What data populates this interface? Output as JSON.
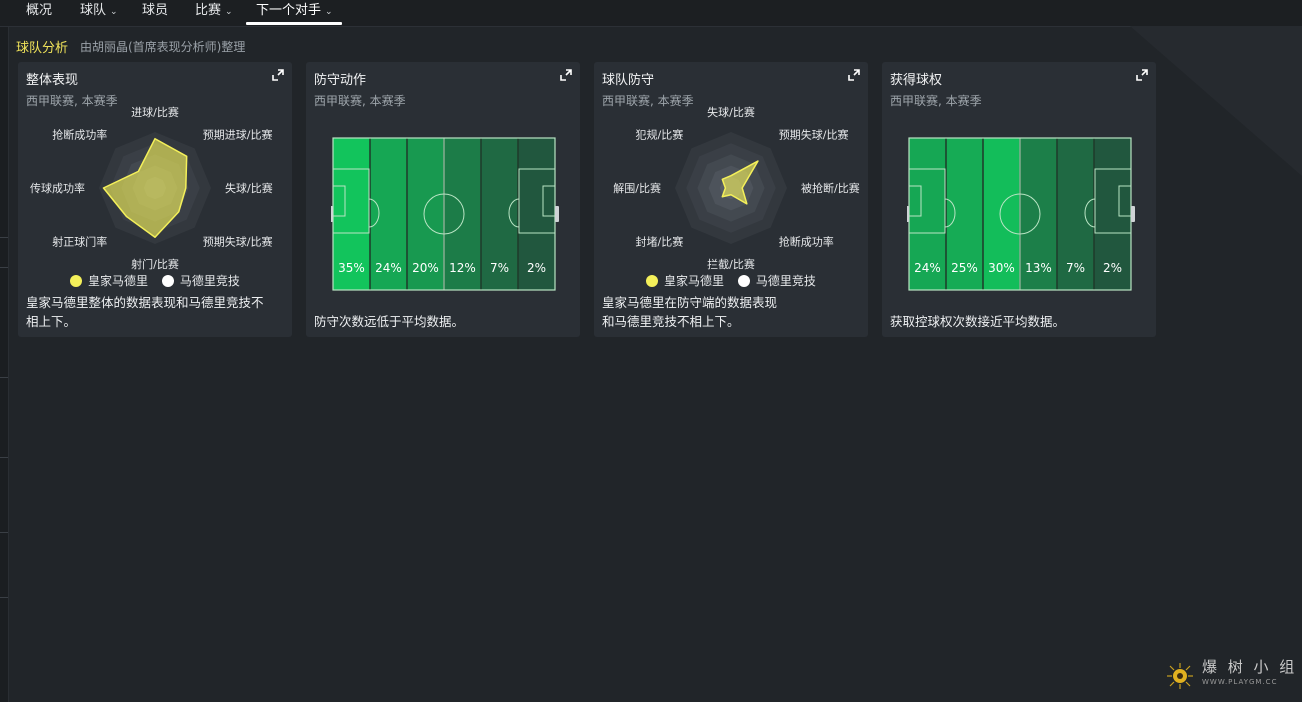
{
  "nav": {
    "items": [
      {
        "label": "概况",
        "dropdown": false
      },
      {
        "label": "球队",
        "dropdown": true
      },
      {
        "label": "球员",
        "dropdown": false
      },
      {
        "label": "比赛",
        "dropdown": true
      },
      {
        "label": "下一个对手",
        "dropdown": true,
        "active": true
      }
    ]
  },
  "section": {
    "title": "球队分析",
    "subtitle": "由胡丽晶(首席表现分析师)整理"
  },
  "cards": [
    {
      "title": "整体表现",
      "subtitle": "西甲联赛, 本赛季",
      "type": "radar",
      "axes": [
        "进球/比赛",
        "预期进球/比赛",
        "失球/比赛",
        "预期失球/比赛",
        "射门/比赛",
        "射正球门率",
        "传球成功率",
        "抢断成功率"
      ],
      "series_values": [
        0.88,
        0.8,
        0.55,
        0.6,
        0.88,
        0.72,
        0.92,
        0.42
      ],
      "legend": [
        "皇家马德里",
        "马德里竞技"
      ],
      "description": [
        "皇家马德里整体的数据表现和马德里竞技不",
        "相上下。"
      ]
    },
    {
      "title": "防守动作",
      "subtitle": "西甲联赛, 本赛季",
      "type": "pitch",
      "zones": [
        "35%",
        "24%",
        "20%",
        "12%",
        "7%",
        "2%"
      ],
      "zone_values": [
        35,
        24,
        20,
        12,
        7,
        2
      ],
      "description": [
        "防守次数远低于平均数据。"
      ]
    },
    {
      "title": "球队防守",
      "subtitle": "西甲联赛, 本赛季",
      "type": "radar",
      "axes": [
        "失球/比赛",
        "预期失球/比赛",
        "被抢断/比赛",
        "抢断成功率",
        "拦截/比赛",
        "封堵/比赛",
        "解围/比赛",
        "犯规/比赛"
      ],
      "series_values": [
        0.22,
        0.68,
        0.2,
        0.4,
        0.12,
        0.22,
        0.1,
        0.22
      ],
      "legend": [
        "皇家马德里",
        "马德里竞技"
      ],
      "description": [
        "皇家马德里在防守端的数据表现",
        "和马德里竞技不相上下。"
      ]
    },
    {
      "title": "获得球权",
      "subtitle": "西甲联赛, 本赛季",
      "type": "pitch",
      "zones": [
        "24%",
        "25%",
        "30%",
        "13%",
        "7%",
        "2%"
      ],
      "zone_values": [
        24,
        25,
        30,
        13,
        7,
        2
      ],
      "description": [
        "获取控球权次数接近平均数据。"
      ]
    }
  ],
  "colors": {
    "accent": "#f0e35a",
    "series_home": "#f4f05a",
    "series_away": "#ffffff",
    "pitch_line": "#b9e4c4"
  },
  "watermark": {
    "text": "爆 树 小 组",
    "url": "WWW.PLAYGM.CC"
  }
}
